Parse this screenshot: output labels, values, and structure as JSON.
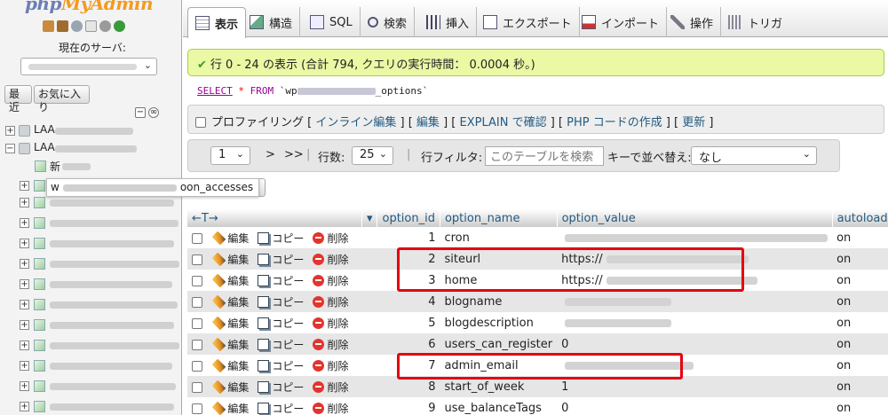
{
  "sidebar": {
    "logo_prefix": "php",
    "logo_suffix": "MyAdmin",
    "server_label": "現在のサーバ:",
    "recent_label": "最近",
    "favorites_label": "お気に入り",
    "tree": [
      {
        "label": "LAA"
      },
      {
        "label": "LAA"
      },
      {
        "label": "新"
      }
    ],
    "tooltip_prefix": "w",
    "tooltip_suffix": "oon_accesses"
  },
  "tabs": [
    {
      "label": "表示",
      "icon": "browse-icon"
    },
    {
      "label": "構造",
      "icon": "structure-icon"
    },
    {
      "label": "SQL",
      "icon": "sql-icon"
    },
    {
      "label": "検索",
      "icon": "search-icon"
    },
    {
      "label": "挿入",
      "icon": "insert-icon"
    },
    {
      "label": "エクスポート",
      "icon": "export-icon"
    },
    {
      "label": "インポート",
      "icon": "import-icon"
    },
    {
      "label": "操作",
      "icon": "operations-icon"
    },
    {
      "label": "トリガ",
      "icon": "triggers-icon"
    }
  ],
  "message": "行 0 - 24 の表示 (合計 794, クエリの実行時間： 0.0004 秒。)",
  "sql": {
    "select": "SELECT",
    "star": "*",
    "from": "FROM",
    "prefix": "`wp",
    "suffix": "_options`"
  },
  "profiling": {
    "label": "プロファイリング",
    "links": [
      "インライン編集",
      "編集",
      "EXPLAIN で確認",
      "PHP コードの作成",
      "更新"
    ]
  },
  "nav": {
    "page": "1",
    "next": ">",
    "last": ">>",
    "rows_label": "行数:",
    "rows_value": "25",
    "filter_label": "行フィルタ:",
    "filter_placeholder": "このテーブルを検索",
    "sort_label": "キーで並べ替え:",
    "sort_value": "なし"
  },
  "table": {
    "headers": [
      "option_id",
      "option_name",
      "option_value",
      "autoload"
    ],
    "actions": {
      "edit": "編集",
      "copy": "コピー",
      "delete": "削除"
    },
    "rows": [
      {
        "id": "1",
        "name": "cron",
        "value": "",
        "autoload": "on"
      },
      {
        "id": "2",
        "name": "siteurl",
        "value": "https://",
        "autoload": "on"
      },
      {
        "id": "3",
        "name": "home",
        "value": "https://",
        "autoload": "on"
      },
      {
        "id": "4",
        "name": "blogname",
        "value": "",
        "autoload": "on"
      },
      {
        "id": "5",
        "name": "blogdescription",
        "value": "",
        "autoload": "on"
      },
      {
        "id": "6",
        "name": "users_can_register",
        "value": "0",
        "autoload": "on"
      },
      {
        "id": "7",
        "name": "admin_email",
        "value": "",
        "autoload": "on"
      },
      {
        "id": "8",
        "name": "start_of_week",
        "value": "1",
        "autoload": "on"
      },
      {
        "id": "9",
        "name": "use_balanceTags",
        "value": "0",
        "autoload": "on"
      }
    ]
  },
  "colors": {
    "highlight": "#e60012",
    "success_bg": "#ebf8a4",
    "link": "#235a81"
  }
}
